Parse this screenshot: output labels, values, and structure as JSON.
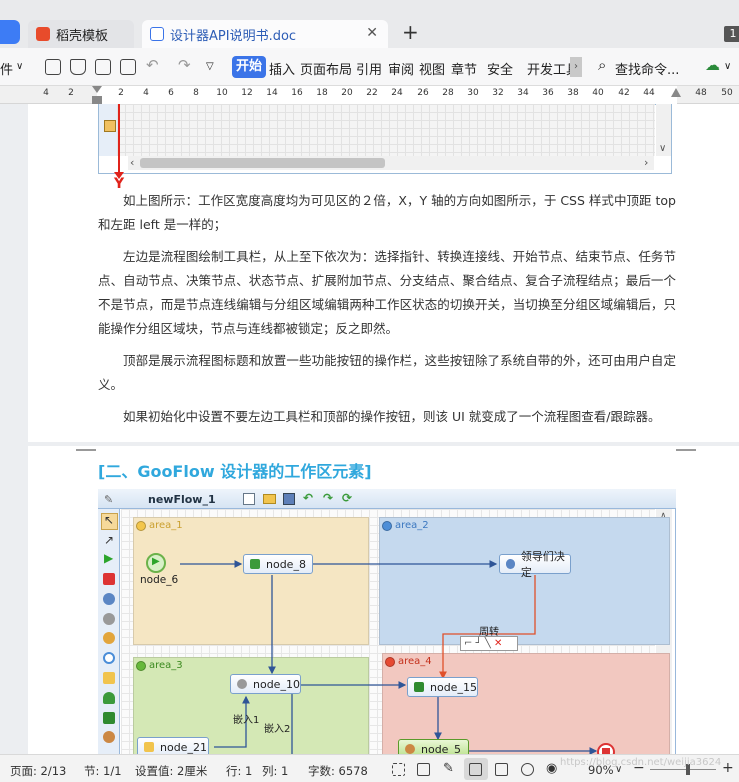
{
  "tabs": [
    {
      "label": "稻壳模板",
      "icon": "daoke-icon"
    },
    {
      "label": "设计器API说明书.doc",
      "icon": "wps-doc-icon"
    }
  ],
  "page_badge": "1",
  "toolbar": {
    "file_menu": "件",
    "ribbon_tabs": [
      "开始",
      "插入",
      "页面布局",
      "引用",
      "审阅",
      "视图",
      "章节",
      "安全",
      "开发工具"
    ],
    "search_label": "查找命令..."
  },
  "ruler": [
    "4",
    "2",
    "2",
    "4",
    "6",
    "8",
    "10",
    "12",
    "14",
    "16",
    "18",
    "20",
    "22",
    "24",
    "26",
    "28",
    "30",
    "32",
    "34",
    "36",
    "38",
    "40",
    "42",
    "44",
    "48",
    "50"
  ],
  "doc": {
    "y_axis_label": "Y",
    "paragraphs": [
      "如上图所示：工作区宽度高度均为可见区的２倍，X，Y 轴的方向如图所示，于 CSS 样式中顶距 top 和左距 left 是一样的；",
      "左边是流程图绘制工具栏，从上至下依次为：选择指针、转换连接线、开始节点、结束节点、任务节点、自动节点、决策节点、状态节点、扩展附加节点、分支结点、聚合结点、复合子流程结点；最后一个不是节点，而是节点连线编辑与分组区域编辑两种工作区状态的切换开关，当切换至分组区域编辑后，只能操作分组区域块，节点与连线都被锁定；反之即然。",
      "顶部是展示流程图标题和放置一些功能按钮的操作栏，这些按钮除了系统自带的外，还可由用户自定义。",
      "如果初始化中设置不要左边工具栏和顶部的操作按钮，则该 UI 就变成了一个流程图查看/跟踪器。"
    ],
    "heading": "[二、GooFlow 设计器的工作区元素]"
  },
  "flow": {
    "title": "newFlow_1",
    "areas": [
      {
        "label": "area_1",
        "color": "#f5e6c3",
        "dot": "#f3c64b"
      },
      {
        "label": "area_2",
        "color": "#c5d9ee",
        "dot": "#4e8fd8"
      },
      {
        "label": "area_3",
        "color": "#d4e8b5",
        "dot": "#66b83a"
      },
      {
        "label": "area_4",
        "color": "#f2c8c0",
        "dot": "#e64a33"
      }
    ],
    "nodes": {
      "start": "node_6",
      "n8": "node_8",
      "leader": "领导们决定",
      "n10": "node_10",
      "n15": "node_15",
      "n21": "node_21",
      "n5": "node_5"
    },
    "edge_labels": {
      "zhuan": "周转",
      "embed1": "嵌入1",
      "embed2": "嵌入2"
    }
  },
  "status": {
    "page": "页面: 2/13",
    "section": "节: 1/1",
    "setting": "设置值: 2厘米",
    "row": "行: 1",
    "col": "列: 1",
    "words": "字数: 6578",
    "zoom": "90%",
    "watermark": "https://blog.csdn.net/weijia3624"
  }
}
